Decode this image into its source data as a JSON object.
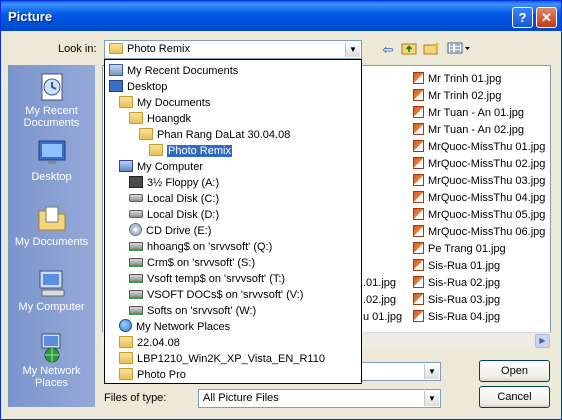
{
  "window": {
    "title": "Picture",
    "help": "?",
    "close": "✕"
  },
  "look_in": {
    "label": "Look in:",
    "value": "Photo Remix"
  },
  "places": [
    {
      "label": "My Recent Documents",
      "icon": "recent-documents-icon"
    },
    {
      "label": "Desktop",
      "icon": "desktop-icon"
    },
    {
      "label": "My Documents",
      "icon": "my-documents-icon"
    },
    {
      "label": "My Computer",
      "icon": "my-computer-icon"
    },
    {
      "label": "My Network Places",
      "icon": "network-places-icon"
    }
  ],
  "dropdown_items": [
    {
      "label": "My Recent Documents",
      "indent": 0,
      "icon": "recent"
    },
    {
      "label": "Desktop",
      "indent": 0,
      "icon": "desk"
    },
    {
      "label": "My Documents",
      "indent": 1,
      "icon": "folder"
    },
    {
      "label": "Hoangdk",
      "indent": 2,
      "icon": "folder"
    },
    {
      "label": "Phan Rang DaLat 30.04.08",
      "indent": 3,
      "icon": "folder"
    },
    {
      "label": "Photo Remix",
      "indent": 4,
      "icon": "folder",
      "selected": true
    },
    {
      "label": "My Computer",
      "indent": 1,
      "icon": "computer"
    },
    {
      "label": "3½ Floppy (A:)",
      "indent": 2,
      "icon": "floppy"
    },
    {
      "label": "Local Disk (C:)",
      "indent": 2,
      "icon": "drive"
    },
    {
      "label": "Local Disk (D:)",
      "indent": 2,
      "icon": "drive"
    },
    {
      "label": "CD Drive (E:)",
      "indent": 2,
      "icon": "cd"
    },
    {
      "label": "hhoang$ on 'srvvsoft' (Q:)",
      "indent": 2,
      "icon": "netdrive"
    },
    {
      "label": "Crm$ on 'srvvsoft' (S:)",
      "indent": 2,
      "icon": "netdrive"
    },
    {
      "label": "Vsoft temp$ on 'srvvsoft' (T:)",
      "indent": 2,
      "icon": "netdrive"
    },
    {
      "label": "VSOFT DOCs$ on 'srvvsoft' (V:)",
      "indent": 2,
      "icon": "netdrive"
    },
    {
      "label": "Softs on 'srvvsoft' (W:)",
      "indent": 2,
      "icon": "netdrive"
    },
    {
      "label": "My Network Places",
      "indent": 1,
      "icon": "globe"
    },
    {
      "label": "22.04.08",
      "indent": 1,
      "icon": "folder"
    },
    {
      "label": "LBP1210_Win2K_XP_Vista_EN_R110",
      "indent": 1,
      "icon": "folder"
    },
    {
      "label": "Photo Pro",
      "indent": 1,
      "icon": "folder"
    }
  ],
  "files_right": [
    "Mr Trinh 01.jpg",
    "Mr Trinh 02.jpg",
    "Mr Tuan - An 01.jpg",
    "Mr Tuan - An 02.jpg",
    "MrQuoc-MissThu 01.jpg",
    "MrQuoc-MissThu 02.jpg",
    "MrQuoc-MissThu 03.jpg",
    "MrQuoc-MissThu 04.jpg",
    "MrQuoc-MissThu 05.jpg",
    "MrQuoc-MissThu 06.jpg",
    "Pe Trang 01.jpg",
    "Sis-Rua 01.jpg",
    "Sis-Rua 02.jpg",
    "Sis-Rua 03.jpg",
    "Sis-Rua 04.jpg"
  ],
  "files_partial": [
    ".01.jpg",
    ".02.jpg",
    "u 01.jpg"
  ],
  "file_type": {
    "label": "Files of type:",
    "value": "All Picture Files"
  },
  "file_name": {
    "value": ""
  },
  "buttons": {
    "open": "Open",
    "cancel": "Cancel"
  }
}
